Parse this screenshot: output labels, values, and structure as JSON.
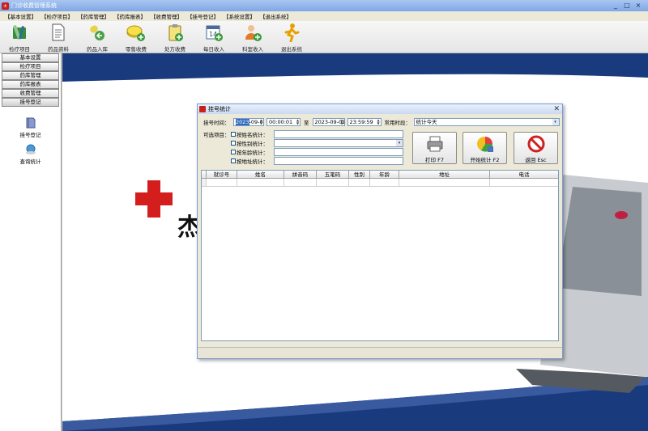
{
  "window": {
    "title": "门诊收费管理系统",
    "min": "_",
    "max": "□",
    "close": "×"
  },
  "menu": [
    "【基本设置】",
    "【检疗项目】",
    "【药库管理】",
    "【药库报表】",
    "【收费管理】",
    "【挂号登记】",
    "【系统设置】",
    "【退出系统】"
  ],
  "toolbar": [
    {
      "label": "检疗项目",
      "icon": "medical-tools-icon"
    },
    {
      "label": "药品资料",
      "icon": "document-icon"
    },
    {
      "label": "药品入库",
      "icon": "medicine-in-icon"
    },
    {
      "label": "零售收费",
      "icon": "coins-icon"
    },
    {
      "label": "处方收费",
      "icon": "clipboard-icon"
    },
    {
      "label": "每日收入",
      "icon": "calendar-icon"
    },
    {
      "label": "科室收入",
      "icon": "user-add-icon"
    },
    {
      "label": "退出系统",
      "icon": "exit-runner-icon"
    }
  ],
  "sidebar": {
    "nav": [
      "基本设置",
      "检疗项目",
      "药库管理",
      "药库报表",
      "收费管理",
      "挂号登记"
    ],
    "active": "挂号登记",
    "items": [
      {
        "label": "挂号登记",
        "icon": "book-icon"
      },
      {
        "label": "查询统计",
        "icon": "search-globe-icon"
      }
    ]
  },
  "desktop": {
    "logo_char": "杰"
  },
  "dialog": {
    "title": "挂号统计",
    "time_label": "挂号时间：",
    "start_date": "2023-09-01",
    "start_date_hl": "2023",
    "start_date_rest": "-09-01",
    "start_time": "00:00:01",
    "to_label": "至",
    "end_date": "2023-09-01",
    "end_time": "23:59:59",
    "common_label": "常用时段：",
    "common_value": "统计今天",
    "options_label": "可选项目：",
    "options": [
      {
        "label": "按姓名统计：",
        "type": "text"
      },
      {
        "label": "按性别统计：",
        "type": "combo"
      },
      {
        "label": "按年龄统计：",
        "type": "text"
      },
      {
        "label": "按地址统计：",
        "type": "text"
      }
    ],
    "buttons": {
      "print": "打印 F7",
      "start": "开始统计 F2",
      "back": "返回 Esc"
    },
    "columns": [
      "就诊号",
      "姓名",
      "拼音码",
      "五笔码",
      "性别",
      "年龄",
      "地址",
      "电话"
    ]
  },
  "colors": {
    "desktop_blue": "#1a3a7e",
    "title_blue": "#7ea7e6",
    "cross_red": "#d41e1e"
  }
}
